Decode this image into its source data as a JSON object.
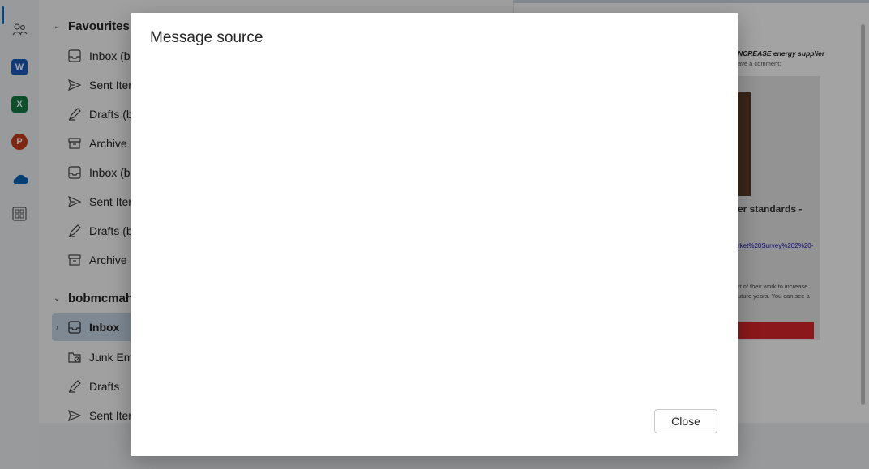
{
  "dialog": {
    "title": "Message source",
    "body_text": "",
    "close_label": "Close"
  },
  "rail": {
    "icons": [
      "people-icon",
      "word-icon",
      "excel-icon",
      "powerpoint-icon",
      "onedrive-icon",
      "apps-icon"
    ],
    "word_letter": "W",
    "excel_letter": "X",
    "powerpoint_letter": "P"
  },
  "folders": {
    "favourites_label": "Favourites",
    "favourites": [
      {
        "label": "Inbox (bo",
        "icon": "inbox-icon"
      },
      {
        "label": "Sent Iter",
        "icon": "send-icon"
      },
      {
        "label": "Drafts (b",
        "icon": "drafts-icon"
      },
      {
        "label": "Archive (",
        "icon": "archive-icon"
      },
      {
        "label": "Inbox (bo",
        "icon": "inbox-icon"
      },
      {
        "label": "Sent Iter",
        "icon": "send-icon"
      },
      {
        "label": "Drafts (b",
        "icon": "drafts-icon"
      },
      {
        "label": "Archive (",
        "icon": "archive-icon"
      }
    ],
    "account_label": "bobmcmah",
    "account_items": [
      {
        "label": "Inbox",
        "icon": "inbox-icon"
      },
      {
        "label": "Junk Ema",
        "icon": "junk-icon"
      },
      {
        "label": "Drafts",
        "icon": "drafts-icon"
      },
      {
        "label": "Sent Iter",
        "icon": "send-icon"
      }
    ]
  },
  "reading": {
    "line1": "NCREASE energy supplier",
    "line2": "ave a comment:",
    "heading": "er standards -",
    "link": "rket%20Survey%202%20-",
    "para1": "rt of their work to increase",
    "para2": "uture years. You can see a"
  },
  "colors": {
    "accent": "#0f6cbd",
    "selected_bg": "#c7d6e8",
    "button_red": "#d9262b"
  }
}
